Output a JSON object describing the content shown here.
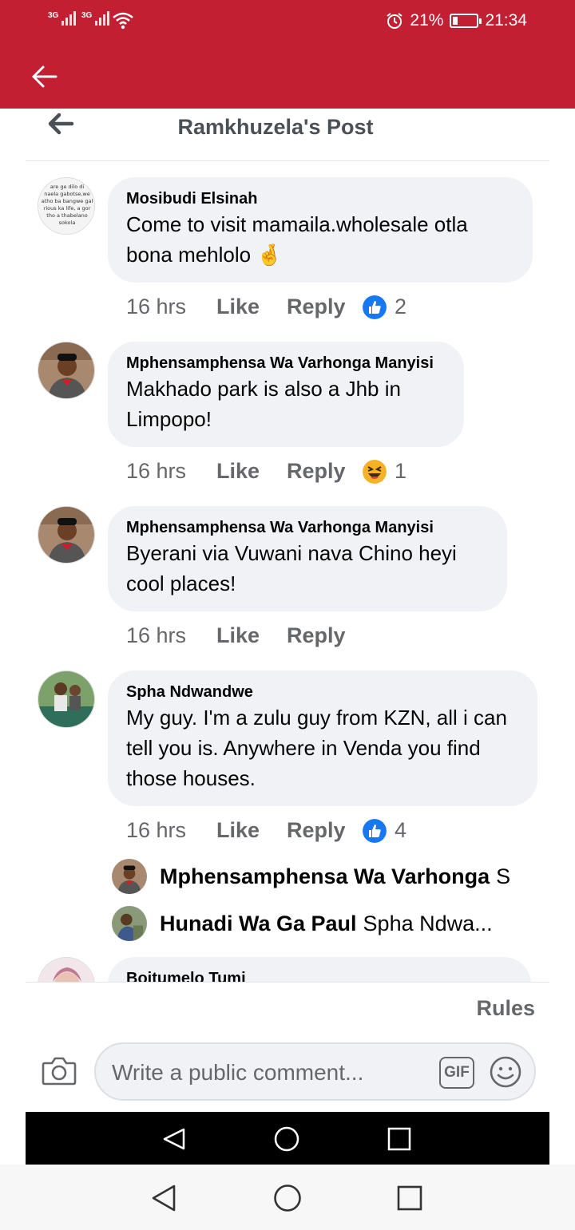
{
  "status": {
    "network1": "3G",
    "network2": "3G",
    "battery_percent": "21%",
    "battery_level": 0.21,
    "time": "21:34"
  },
  "app_bar": {
    "back_icon": "arrow-left-icon"
  },
  "post_header": {
    "title": "Ramkhuzela's Post",
    "back_icon": "arrow-left-icon"
  },
  "comments": [
    {
      "name": "Mosibudi Elsinah",
      "text": "Come to visit mamaila.wholesale otla bona mehlolo 🤞",
      "time": "16 hrs",
      "like": "Like",
      "reply": "Reply",
      "reaction_icon": "like-icon",
      "reaction_count": "2",
      "avatar_text": "are ge dilo di naela gabotse,we atho ba bangwe gal rious ka life, a gor tho a thabelano sokola"
    },
    {
      "name": "Mphensamphensa Wa Varhonga Manyisi",
      "text": "Makhado park is also a Jhb in Limpopo!",
      "time": "16 hrs",
      "like": "Like",
      "reply": "Reply",
      "reaction_icon": "haha-icon",
      "reaction_count": "1"
    },
    {
      "name": "Mphensamphensa Wa Varhonga Manyisi",
      "text": "Byerani via Vuwani nava Chino heyi cool places!",
      "time": "16 hrs",
      "like": "Like",
      "reply": "Reply"
    },
    {
      "name": "Spha Ndwandwe",
      "text": "My guy. I'm a zulu guy from KZN, all i can tell you is. Anywhere in Venda you find those houses.",
      "time": "16 hrs",
      "like": "Like",
      "reply": "Reply",
      "reaction_icon": "like-icon",
      "reaction_count": "4",
      "replies": [
        {
          "name": "Mphensamphensa Wa Varhonga",
          "text": "S"
        },
        {
          "name": "Hunadi Wa Ga Paul",
          "text": "Spha Ndwa..."
        }
      ]
    },
    {
      "name": "Boitumelo Tumi"
    }
  ],
  "footer": {
    "rules": "Rules",
    "composer_placeholder": "Write a public comment...",
    "gif_label": "GIF",
    "camera_icon": "camera-icon",
    "emoji_icon": "emoji-icon"
  },
  "nav": {
    "back_icon": "nav-back-icon",
    "home_icon": "nav-home-icon",
    "recents_icon": "nav-recents-icon"
  },
  "colors": {
    "app_bar": "#c21f32",
    "bubble": "#f0f2f5",
    "like_blue": "#1877f2",
    "muted": "#65676b"
  }
}
